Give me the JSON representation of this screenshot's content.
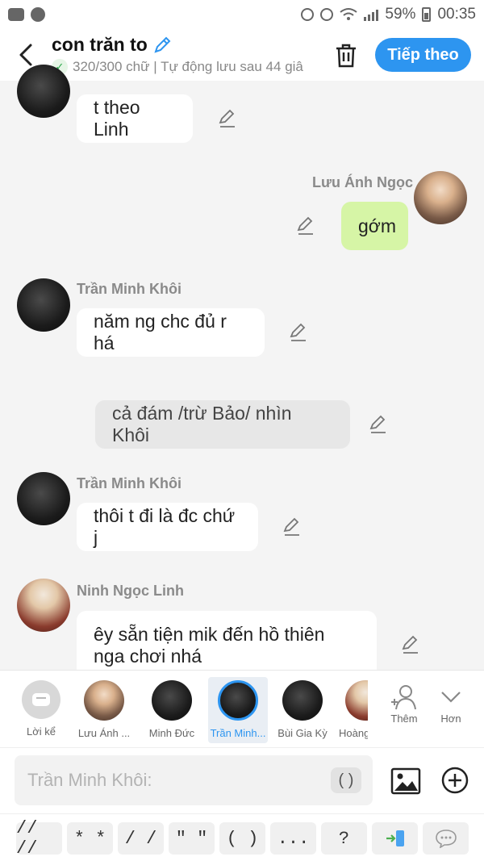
{
  "status_bar": {
    "battery": "59%",
    "time": "00:35"
  },
  "header": {
    "title": "con trăn to",
    "subtitle": "320/300 chữ | Tự động lưu sau 44 giâ",
    "next_label": "Tiếp theo"
  },
  "messages": [
    {
      "text": "t theo Linh"
    },
    {
      "sender": "Lưu Ánh Ngọc",
      "text": "gớm"
    },
    {
      "sender": "Trần Minh Khôi",
      "text": "năm ng chc đủ r há"
    },
    {
      "text": "cả đám /trừ Bảo/ nhìn Khôi"
    },
    {
      "sender": "Trần Minh Khôi",
      "text": "thôi t đi là đc chứ j"
    },
    {
      "sender": "Ninh Ngọc Linh",
      "text": "êy sẵn tiện mik đến hồ thiên nga chơi nhá"
    }
  ],
  "characters": [
    {
      "name": "Lời kể"
    },
    {
      "name": "Lưu Ánh ..."
    },
    {
      "name": "Minh Đức"
    },
    {
      "name": "Trần Minh..."
    },
    {
      "name": "Bùi Gia Kỳ"
    },
    {
      "name": "Hoàng"
    }
  ],
  "tools": {
    "add_label": "Thêm",
    "more_label": "Hơn"
  },
  "composer": {
    "placeholder": "Trần Minh Khôi:",
    "paren": "( )"
  },
  "symbols": [
    "// //",
    "* *",
    "/ /",
    "\" \"",
    "( )",
    "...",
    "?"
  ],
  "colors": {
    "accent": "#2d95f0",
    "own_bubble": "#d6f5a6",
    "narration_bubble": "#e7e7e7"
  },
  "icons": [
    "youtube-icon",
    "chrome-icon",
    "recycle-icon",
    "alarm-icon",
    "wifi-icon",
    "signal-icon",
    "battery-icon",
    "back-icon",
    "pencil-icon",
    "check-icon",
    "trash-icon",
    "chat-icon",
    "person-add-icon",
    "chevron-down-icon",
    "image-icon",
    "plus-circle-icon",
    "switch-icon",
    "more-bubble-icon"
  ]
}
